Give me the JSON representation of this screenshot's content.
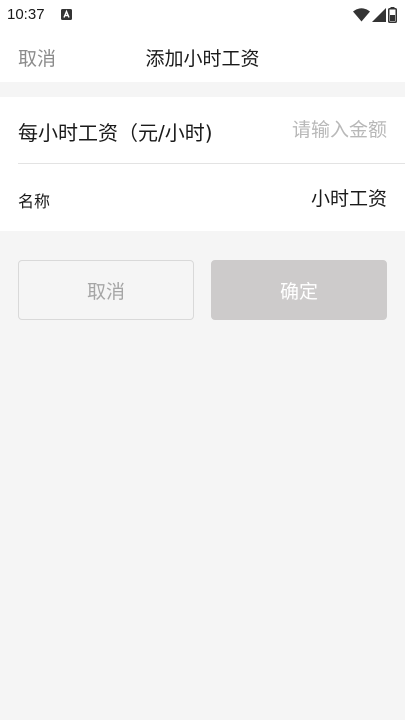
{
  "status_bar": {
    "time": "10:37",
    "icons": [
      "a-notification-icon",
      "wifi-icon",
      "signal-icon",
      "battery-icon"
    ]
  },
  "header": {
    "cancel_label": "取消",
    "title": "添加小时工资"
  },
  "form": {
    "hourly_wage": {
      "label": "每小时工资（元/小时)",
      "value": "",
      "placeholder": "请输入金额"
    },
    "name": {
      "label": "名称",
      "value": "小时工资"
    }
  },
  "buttons": {
    "cancel_label": "取消",
    "confirm_label": "确定"
  },
  "colors": {
    "background": "#f5f5f5",
    "surface": "#ffffff",
    "text_primary": "#1a1a1a",
    "text_secondary": "#8c8c8c",
    "placeholder": "#b8b8b8",
    "confirm_disabled": "#cdcbcb"
  }
}
